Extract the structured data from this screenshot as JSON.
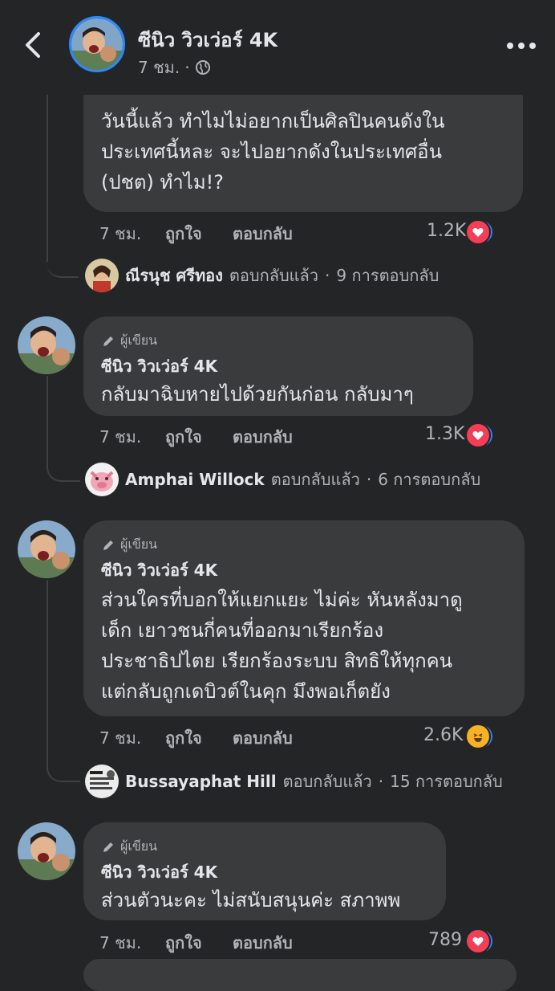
{
  "header": {
    "page_name": "ซีนิว วิวเว่อร์ 4K",
    "time": "7 ชม.",
    "dot": "·"
  },
  "top_comment": {
    "text_lines": [
      "วันนี้แล้ว ทำไมไม่อยากเป็นศิลปินคนดังใน",
      "ประเทศนี้หละ จะไปอยากดังในประเทศอื่น",
      "(ปชต) ทำไม!?"
    ],
    "time": "7 ชม.",
    "like_label": "ถูกใจ",
    "reply_label": "ตอบกลับ",
    "reaction_count": "1.2K",
    "reactions": [
      "like",
      "haha",
      "love"
    ],
    "reply_summary": {
      "name": "ณีรนุช ศรีทอง",
      "action": "ตอบกลับแล้ว",
      "sep": "·",
      "count": "9 การตอบกลับ"
    }
  },
  "comments": [
    {
      "badge": "ผู้เขียน",
      "name": "ซีนิว วิวเว่อร์ 4K",
      "text_lines": [
        "กลับมาฉิบหายไปด้วยกันก่อน กลับมาๆ"
      ],
      "time": "7 ชม.",
      "like_label": "ถูกใจ",
      "reply_label": "ตอบกลับ",
      "reaction_count": "1.3K",
      "reactions": [
        "like",
        "haha",
        "love"
      ],
      "reply_summary": {
        "name": "Amphai Willock",
        "action": "ตอบกลับแล้ว",
        "sep": "·",
        "count": "6 การตอบกลับ"
      }
    },
    {
      "badge": "ผู้เขียน",
      "name": "ซีนิว วิวเว่อร์ 4K",
      "text_lines": [
        "ส่วนใครที่บอกให้แยกแยะ ไม่ค่ะ หันหลังมาดู",
        "เด็ก เยาวชนกี่คนที่ออกมาเรียกร้อง",
        "ประชาธิปไตย เรียกร้องระบบ สิทธิให้ทุกคน",
        "แต่กลับถูกเดบิวต์ในคุก มึงพอเก็ตยัง"
      ],
      "time": "7 ชม.",
      "like_label": "ถูกใจ",
      "reply_label": "ตอบกลับ",
      "reaction_count": "2.6K",
      "reactions": [
        "like",
        "love",
        "haha"
      ],
      "reply_summary": {
        "name": "Bussayaphat Hill",
        "action": "ตอบกลับแล้ว",
        "sep": "·",
        "count": "15 การตอบกลับ"
      }
    },
    {
      "badge": "ผู้เขียน",
      "name": "ซีนิว วิวเว่อร์ 4K",
      "text_lines": [
        "ส่วนตัวนะคะ ไม่สนับสนุนค่ะ สภาพพ"
      ],
      "time": "7 ชม.",
      "like_label": "ถูกใจ",
      "reply_label": "ตอบกลับ",
      "reaction_count": "789",
      "reactions": [
        "like",
        "haha",
        "love"
      ]
    }
  ],
  "colors": {
    "background": "#242526",
    "bubble": "#3a3b3c",
    "text": "#e4e6eb",
    "muted": "#b0b3b8",
    "like": "#2d88ff",
    "haha": "#f7b125",
    "love": "#f33e58"
  }
}
